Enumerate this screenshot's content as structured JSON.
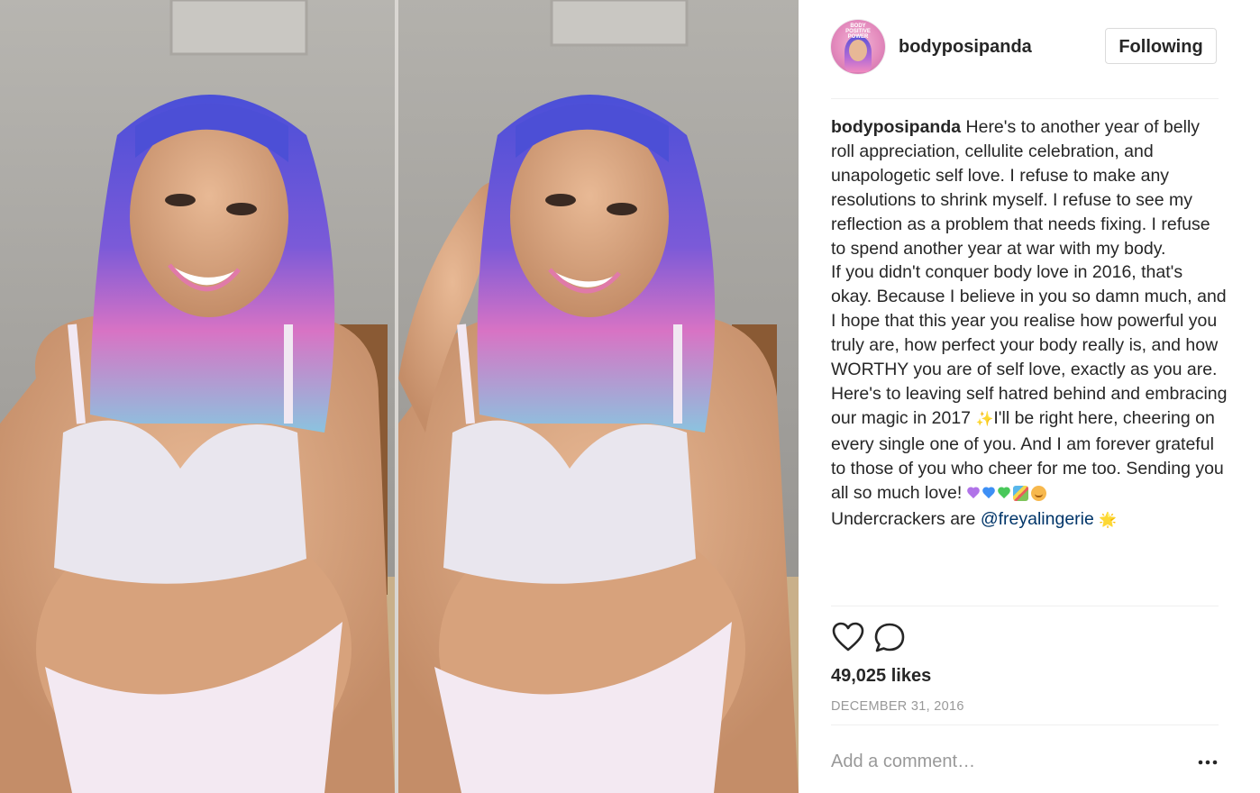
{
  "post": {
    "username": "bodyposipanda",
    "follow_button": "Following",
    "avatar_text": "BODY POSITIVE POWER",
    "caption": {
      "author": "bodyposipanda",
      "paragraph1": " Here's to another year of belly roll appreciation, cellulite celebration, and unapologetic self love. I refuse to make any resolutions to shrink myself. I refuse to see my reflection as a problem that needs fixing. I refuse to spend another year at war with my body.",
      "paragraph2_a": "If you didn't conquer body love in 2016, that's okay. Because I believe in you so damn much, and I hope that this year you realise how powerful you truly are, how perfect your body really is, and how WORTHY you are of self love, exactly as you are. Here's to leaving self hatred behind and embracing our magic in 2017 ",
      "paragraph2_b": "I'll be right here, cheering on every single one of you. And I am forever grateful to those of you who cheer for me too. Sending you all so much love! ",
      "credit_prefix": "Undercrackers are ",
      "credit_mention": "@freyalingerie",
      "sparkle_glyph": "✨",
      "star_glyph": "🌟"
    },
    "heart_colors": [
      "#b073e8",
      "#3d8ff5",
      "#49c85a"
    ],
    "likes": "49,025 likes",
    "date": "DECEMBER 31, 2016",
    "comment_placeholder": "Add a comment…",
    "icons": [
      "heart-outline-icon",
      "comment-bubble-icon",
      "more-options-icon"
    ],
    "colors": {
      "mention": "#003569",
      "text": "#262626",
      "muted": "#999999",
      "border": "#efefef"
    }
  }
}
